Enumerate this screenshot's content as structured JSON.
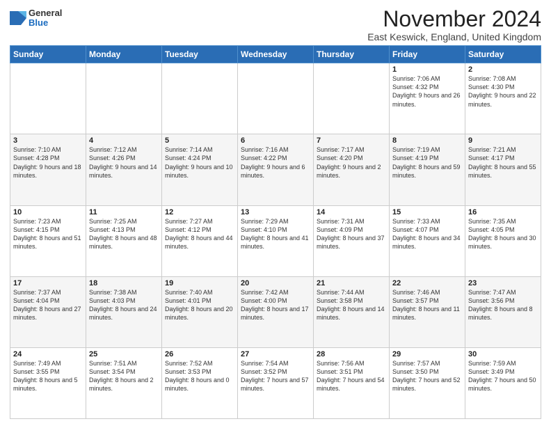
{
  "header": {
    "logo": {
      "general": "General",
      "blue": "Blue"
    },
    "title": "November 2024",
    "subtitle": "East Keswick, England, United Kingdom"
  },
  "weekdays": [
    "Sunday",
    "Monday",
    "Tuesday",
    "Wednesday",
    "Thursday",
    "Friday",
    "Saturday"
  ],
  "weeks": [
    [
      {
        "day": "",
        "info": ""
      },
      {
        "day": "",
        "info": ""
      },
      {
        "day": "",
        "info": ""
      },
      {
        "day": "",
        "info": ""
      },
      {
        "day": "",
        "info": ""
      },
      {
        "day": "1",
        "info": "Sunrise: 7:06 AM\nSunset: 4:32 PM\nDaylight: 9 hours and 26 minutes."
      },
      {
        "day": "2",
        "info": "Sunrise: 7:08 AM\nSunset: 4:30 PM\nDaylight: 9 hours and 22 minutes."
      }
    ],
    [
      {
        "day": "3",
        "info": "Sunrise: 7:10 AM\nSunset: 4:28 PM\nDaylight: 9 hours and 18 minutes."
      },
      {
        "day": "4",
        "info": "Sunrise: 7:12 AM\nSunset: 4:26 PM\nDaylight: 9 hours and 14 minutes."
      },
      {
        "day": "5",
        "info": "Sunrise: 7:14 AM\nSunset: 4:24 PM\nDaylight: 9 hours and 10 minutes."
      },
      {
        "day": "6",
        "info": "Sunrise: 7:16 AM\nSunset: 4:22 PM\nDaylight: 9 hours and 6 minutes."
      },
      {
        "day": "7",
        "info": "Sunrise: 7:17 AM\nSunset: 4:20 PM\nDaylight: 9 hours and 2 minutes."
      },
      {
        "day": "8",
        "info": "Sunrise: 7:19 AM\nSunset: 4:19 PM\nDaylight: 8 hours and 59 minutes."
      },
      {
        "day": "9",
        "info": "Sunrise: 7:21 AM\nSunset: 4:17 PM\nDaylight: 8 hours and 55 minutes."
      }
    ],
    [
      {
        "day": "10",
        "info": "Sunrise: 7:23 AM\nSunset: 4:15 PM\nDaylight: 8 hours and 51 minutes."
      },
      {
        "day": "11",
        "info": "Sunrise: 7:25 AM\nSunset: 4:13 PM\nDaylight: 8 hours and 48 minutes."
      },
      {
        "day": "12",
        "info": "Sunrise: 7:27 AM\nSunset: 4:12 PM\nDaylight: 8 hours and 44 minutes."
      },
      {
        "day": "13",
        "info": "Sunrise: 7:29 AM\nSunset: 4:10 PM\nDaylight: 8 hours and 41 minutes."
      },
      {
        "day": "14",
        "info": "Sunrise: 7:31 AM\nSunset: 4:09 PM\nDaylight: 8 hours and 37 minutes."
      },
      {
        "day": "15",
        "info": "Sunrise: 7:33 AM\nSunset: 4:07 PM\nDaylight: 8 hours and 34 minutes."
      },
      {
        "day": "16",
        "info": "Sunrise: 7:35 AM\nSunset: 4:05 PM\nDaylight: 8 hours and 30 minutes."
      }
    ],
    [
      {
        "day": "17",
        "info": "Sunrise: 7:37 AM\nSunset: 4:04 PM\nDaylight: 8 hours and 27 minutes."
      },
      {
        "day": "18",
        "info": "Sunrise: 7:38 AM\nSunset: 4:03 PM\nDaylight: 8 hours and 24 minutes."
      },
      {
        "day": "19",
        "info": "Sunrise: 7:40 AM\nSunset: 4:01 PM\nDaylight: 8 hours and 20 minutes."
      },
      {
        "day": "20",
        "info": "Sunrise: 7:42 AM\nSunset: 4:00 PM\nDaylight: 8 hours and 17 minutes."
      },
      {
        "day": "21",
        "info": "Sunrise: 7:44 AM\nSunset: 3:58 PM\nDaylight: 8 hours and 14 minutes."
      },
      {
        "day": "22",
        "info": "Sunrise: 7:46 AM\nSunset: 3:57 PM\nDaylight: 8 hours and 11 minutes."
      },
      {
        "day": "23",
        "info": "Sunrise: 7:47 AM\nSunset: 3:56 PM\nDaylight: 8 hours and 8 minutes."
      }
    ],
    [
      {
        "day": "24",
        "info": "Sunrise: 7:49 AM\nSunset: 3:55 PM\nDaylight: 8 hours and 5 minutes."
      },
      {
        "day": "25",
        "info": "Sunrise: 7:51 AM\nSunset: 3:54 PM\nDaylight: 8 hours and 2 minutes."
      },
      {
        "day": "26",
        "info": "Sunrise: 7:52 AM\nSunset: 3:53 PM\nDaylight: 8 hours and 0 minutes."
      },
      {
        "day": "27",
        "info": "Sunrise: 7:54 AM\nSunset: 3:52 PM\nDaylight: 7 hours and 57 minutes."
      },
      {
        "day": "28",
        "info": "Sunrise: 7:56 AM\nSunset: 3:51 PM\nDaylight: 7 hours and 54 minutes."
      },
      {
        "day": "29",
        "info": "Sunrise: 7:57 AM\nSunset: 3:50 PM\nDaylight: 7 hours and 52 minutes."
      },
      {
        "day": "30",
        "info": "Sunrise: 7:59 AM\nSunset: 3:49 PM\nDaylight: 7 hours and 50 minutes."
      }
    ]
  ]
}
